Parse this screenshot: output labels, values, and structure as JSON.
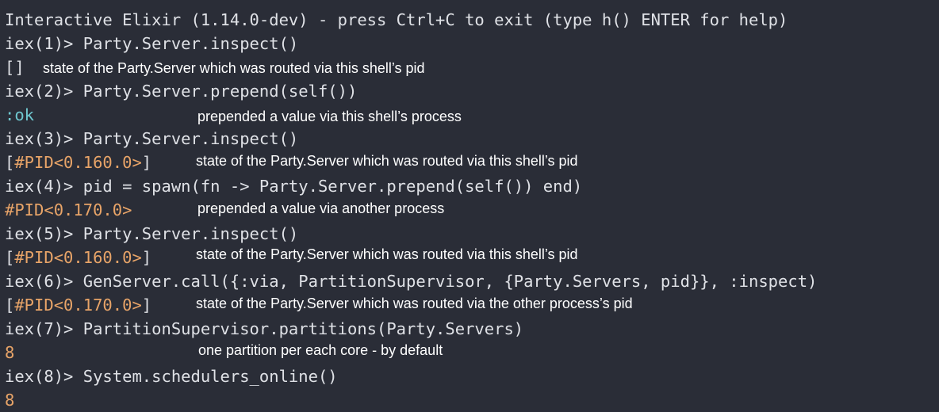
{
  "colors": {
    "background": "#2a2d37",
    "text": "#dfe1e6",
    "pid": "#e8a468",
    "atom": "#6fc7cf",
    "annotation": "#ffffff"
  },
  "banner": "Interactive Elixir (1.14.0-dev) - press Ctrl+C to exit (type h() ENTER for help)",
  "lines": {
    "l1": "iex(1)> Party.Server.inspect()",
    "l2_out": "[]",
    "l2_note": "state of the Party.Server which was routed via this shell’s pid",
    "l3": "iex(2)> Party.Server.prepend(self())",
    "l4_out": ":ok",
    "l4_note": "prepended a value via this shell’s process",
    "l5": "iex(3)> Party.Server.inspect()",
    "l6_open": "[",
    "l6_pid": "#PID<0.160.0>",
    "l6_close": "]",
    "l6_note": "state of the Party.Server which was routed via this shell’s pid",
    "l7": "iex(4)> pid = spawn(fn -> Party.Server.prepend(self()) end)",
    "l8_pid": "#PID<0.170.0>",
    "l8_note": "prepended a value via another process",
    "l9": "iex(5)> Party.Server.inspect()",
    "l10_open": "[",
    "l10_pid": "#PID<0.160.0>",
    "l10_close": "]",
    "l10_note": "state of the Party.Server which was routed via this shell’s pid",
    "l11": "iex(6)> GenServer.call({:via, PartitionSupervisor, {Party.Servers, pid}}, :inspect)",
    "l12_open": "[",
    "l12_pid": "#PID<0.170.0>",
    "l12_close": "]",
    "l12_note": "state of the Party.Server which was routed via the other process’s pid",
    "l13": "iex(7)> PartitionSupervisor.partitions(Party.Servers)",
    "l14_out": "8",
    "l14_note": "one partition per each core - by default",
    "l15": "iex(8)> System.schedulers_online()",
    "l16_out": "8"
  }
}
